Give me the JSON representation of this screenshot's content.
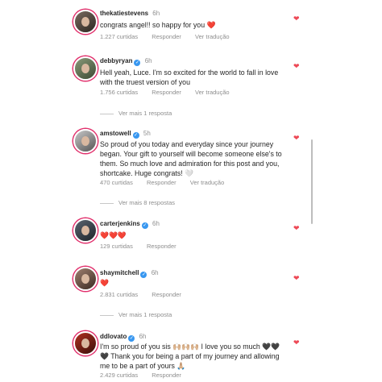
{
  "comments": [
    {
      "username": "thekatiestevens",
      "verified": false,
      "time": "6h",
      "text": "congrats angel!! so happy for you ❤️",
      "likes": "1.227 curtidas",
      "reply": "Responder",
      "translate": "Ver tradução",
      "more_replies": ""
    },
    {
      "username": "debbyryan",
      "verified": true,
      "time": "6h",
      "text": "Hell yeah, Luce. I'm so excited for the world to fall in love with the truest version of you",
      "likes": "1.756 curtidas",
      "reply": "Responder",
      "translate": "Ver tradução",
      "more_replies": "Ver mais 1 resposta"
    },
    {
      "username": "amstowell",
      "verified": true,
      "time": "5h",
      "text": "So proud of you today and everyday since your journey began. Your gift to yourself will become someone else's to them. So much love and admiration for this post and you, shortcake. Huge congrats! 🤍",
      "likes": "470 curtidas",
      "reply": "Responder",
      "translate": "Ver tradução",
      "more_replies": "Ver mais 8 respostas"
    },
    {
      "username": "carterjenkins",
      "verified": true,
      "time": "6h",
      "text": "❤️❤️❤️",
      "likes": "129 curtidas",
      "reply": "Responder",
      "translate": "",
      "more_replies": ""
    },
    {
      "username": "shaymitchell",
      "verified": true,
      "time": "6h",
      "text": "❤️",
      "likes": "2.831 curtidas",
      "reply": "Responder",
      "translate": "",
      "more_replies": "Ver mais 1 resposta"
    },
    {
      "username": "ddlovato",
      "verified": true,
      "time": "6h",
      "text": "I'm so proud of you sis 🙌🏼🙌🏼🙌🏼 I love you so much 🖤🖤🖤 Thank you for being a part of my journey and allowing me to be a part of yours 🙏🏼",
      "likes": "2.429 curtidas",
      "reply": "Responder",
      "translate": "",
      "more_replies": ""
    }
  ],
  "verified_icon": "✓",
  "like_icon": "heart-icon",
  "colors": {
    "accent": "#ed4956",
    "verified": "#3897f0",
    "muted": "#8e8e8e",
    "story_ring": "#e1306c"
  }
}
